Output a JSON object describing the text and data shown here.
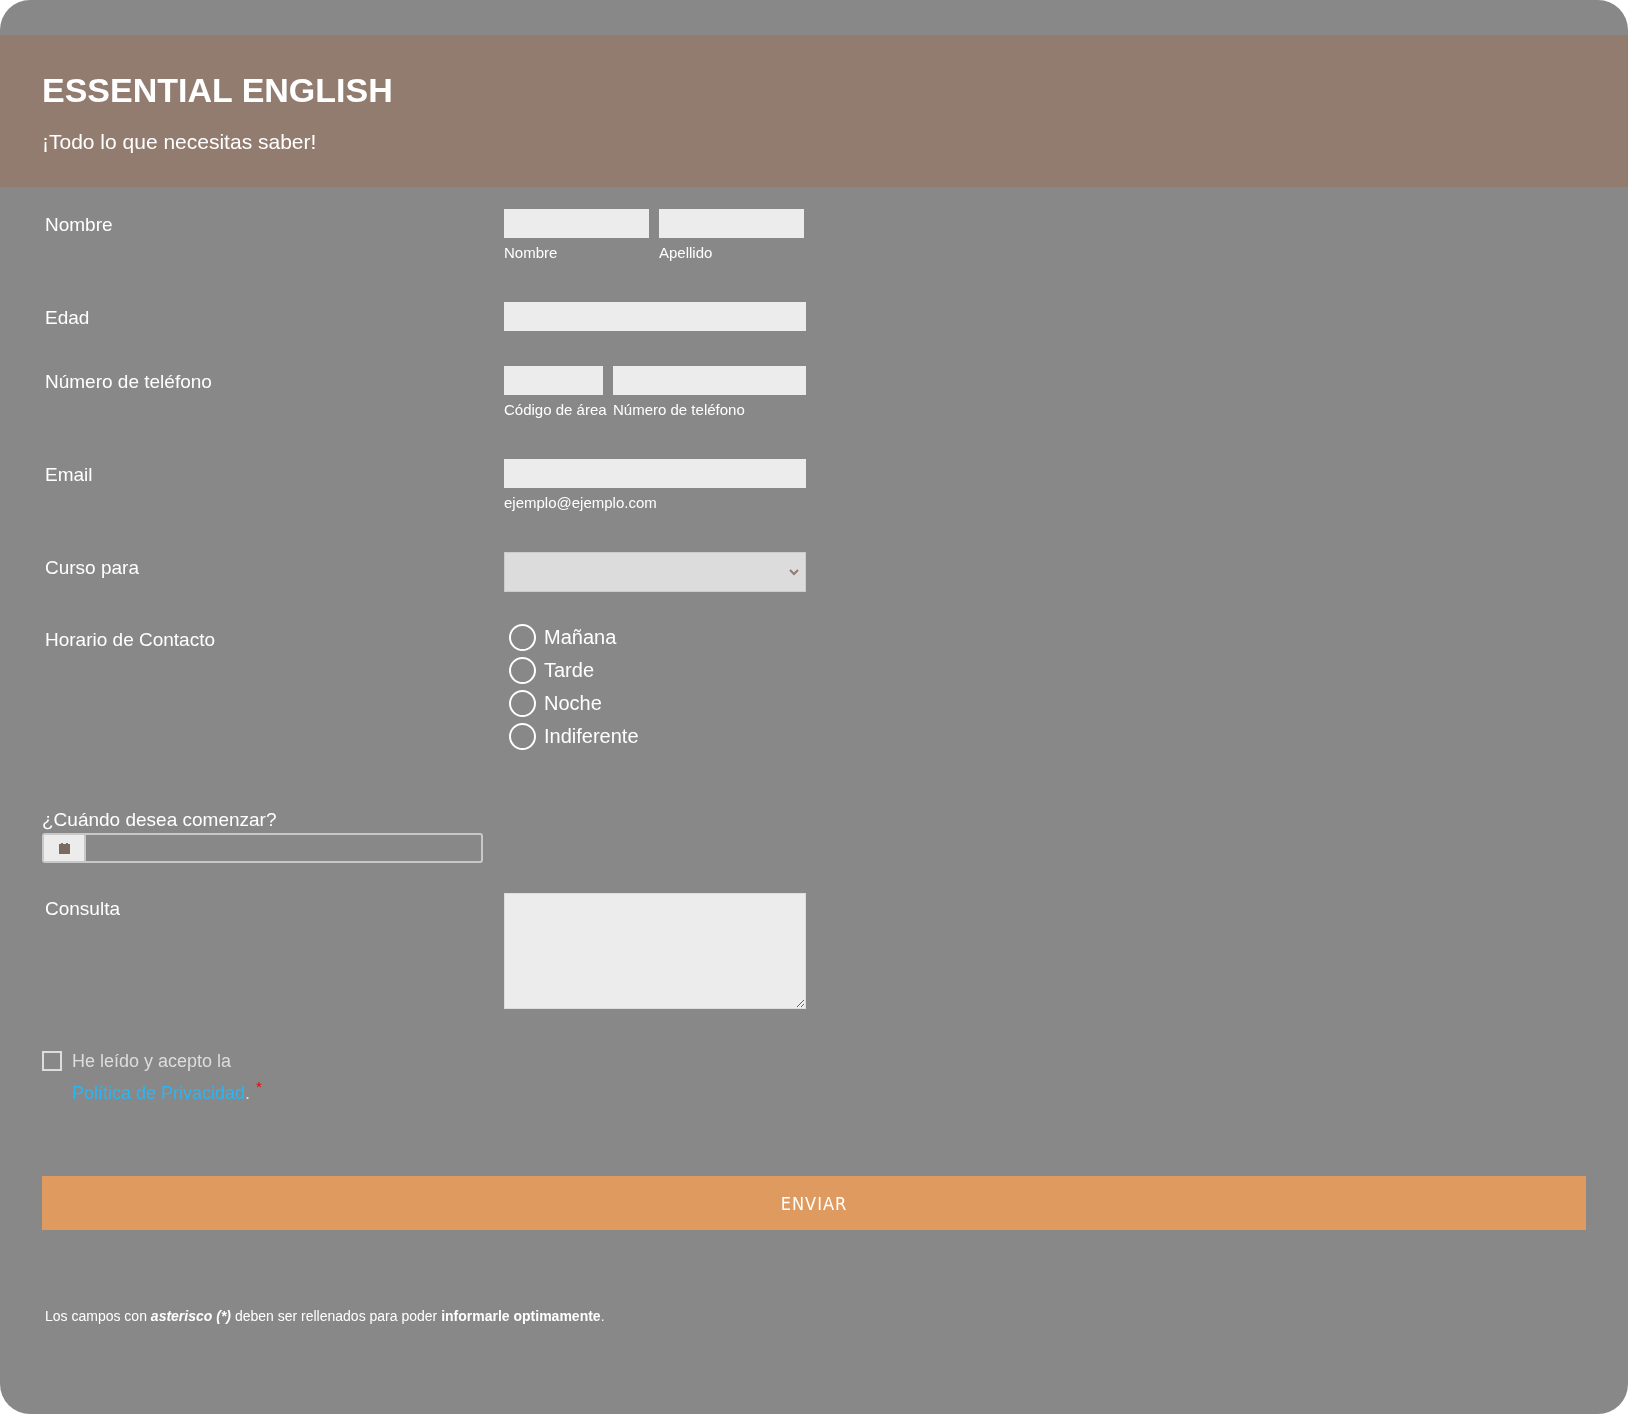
{
  "header": {
    "title": "ESSENTIAL ENGLISH",
    "subtitle": "¡Todo lo que necesitas saber!"
  },
  "fields": [
    {
      "kind": "name",
      "label": "Nombre",
      "inputs": [
        {
          "sublabel": "Nombre"
        },
        {
          "sublabel": "Apellido"
        }
      ]
    },
    {
      "kind": "text",
      "label": "Edad"
    },
    {
      "kind": "phone",
      "label": "Número de teléfono",
      "inputs": [
        {
          "sublabel": "Código de área"
        },
        {
          "sublabel": "Número de teléfono"
        }
      ]
    },
    {
      "kind": "email",
      "label": "Email",
      "inputs": [
        {
          "sublabel": "ejemplo@ejemplo.com"
        }
      ]
    },
    {
      "kind": "select",
      "label": "Curso para"
    },
    {
      "kind": "radio",
      "label": "Horario de Contacto",
      "options": [
        {
          "label": "Mañana",
          "selected": false
        },
        {
          "label": "Tarde",
          "selected": false
        },
        {
          "label": "Noche",
          "selected": false
        },
        {
          "label": "Indiferente",
          "selected": false
        }
      ]
    },
    {
      "kind": "date",
      "label": "¿Cuándo desea comenzar?"
    },
    {
      "kind": "textarea",
      "label": "Consulta"
    }
  ],
  "consent": {
    "checked": false,
    "text": "He leído y acepto la",
    "link": "Política de Privacidad",
    "after": ".",
    "required": "*"
  },
  "submit": "ENVIAR",
  "footnote": [
    {
      "text": "Los campos con ",
      "kind": "plain"
    },
    {
      "text": "asterisco (*)",
      "kind": "emphasis"
    },
    {
      "text": " deben ser rellenados para  poder ",
      "kind": "plain"
    },
    {
      "text": "informarle optimamente",
      "kind": "strong"
    },
    {
      "text": ".",
      "kind": "plain"
    }
  ]
}
